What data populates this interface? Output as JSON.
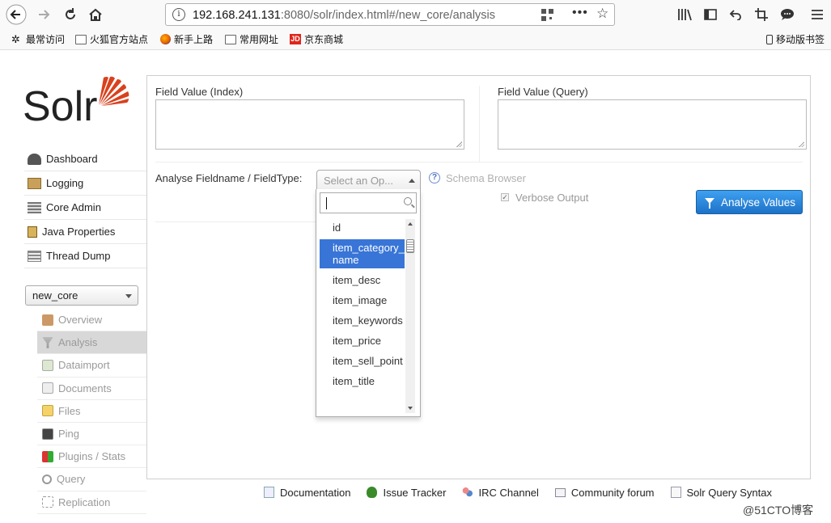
{
  "browser": {
    "url_host": "192.168.241.131",
    "url_rest": ":8080/solr/index.html#/new_core/analysis",
    "bookmarks": [
      "最常访问",
      "火狐官方站点",
      "新手上路",
      "常用网址",
      "京东商城"
    ],
    "mobile_bookmarks": "移动版书签",
    "jd_mark": "JD"
  },
  "app": {
    "logo": "Solr",
    "menu": [
      "Dashboard",
      "Logging",
      "Core Admin",
      "Java Properties",
      "Thread Dump"
    ],
    "core_selected": "new_core",
    "submenu": [
      "Overview",
      "Analysis",
      "Dataimport",
      "Documents",
      "Files",
      "Ping",
      "Plugins / Stats",
      "Query",
      "Replication"
    ],
    "submenu_active": "Analysis"
  },
  "analysis": {
    "index_label": "Field Value (Index)",
    "query_label": "Field Value (Query)",
    "fieldtype_label": "Analyse Fieldname / FieldType:",
    "select_placeholder": "Select an Op...",
    "schema_browser": "Schema Browser",
    "verbose_label": "Verbose Output",
    "analyse_button": "Analyse Values",
    "dropdown_options": [
      "id",
      "item_category_name",
      "item_desc",
      "item_image",
      "item_keywords",
      "item_price",
      "item_sell_point",
      "item_title"
    ],
    "dropdown_highlighted": "item_category_name"
  },
  "footer": {
    "links": [
      "Documentation",
      "Issue Tracker",
      "IRC Channel",
      "Community forum",
      "Solr Query Syntax"
    ]
  },
  "watermark": "@51CTO博客",
  "colors": {
    "accent_blue": "#3875d7",
    "button_blue": "#1d72c8",
    "solr_orange": "#d9411e"
  }
}
